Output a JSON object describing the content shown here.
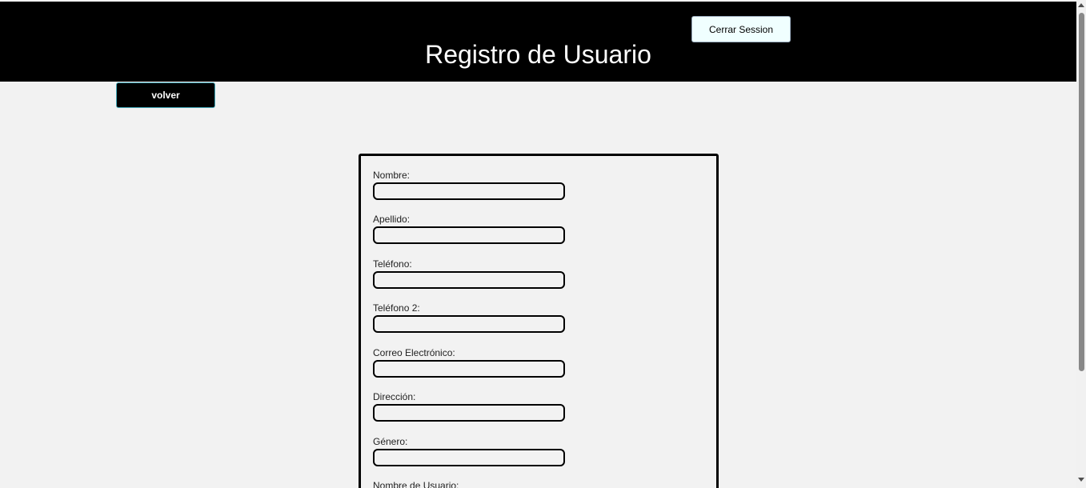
{
  "header": {
    "title": "Registro de Usuario",
    "logout_label": "Cerrar Session"
  },
  "nav": {
    "back_label": "volver"
  },
  "form": {
    "fields": [
      {
        "label": "Nombre:",
        "value": ""
      },
      {
        "label": "Apellido:",
        "value": ""
      },
      {
        "label": "Teléfono:",
        "value": ""
      },
      {
        "label": "Teléfono 2:",
        "value": ""
      },
      {
        "label": "Correo Electrónico:",
        "value": ""
      },
      {
        "label": "Dirección:",
        "value": ""
      },
      {
        "label": "Género:",
        "value": ""
      },
      {
        "label": "Nombre de Usuario:",
        "value": ""
      }
    ]
  },
  "colors": {
    "header_bg": "#000000",
    "page_bg": "#f2f2f2",
    "logout_bg": "#f0ffff"
  }
}
